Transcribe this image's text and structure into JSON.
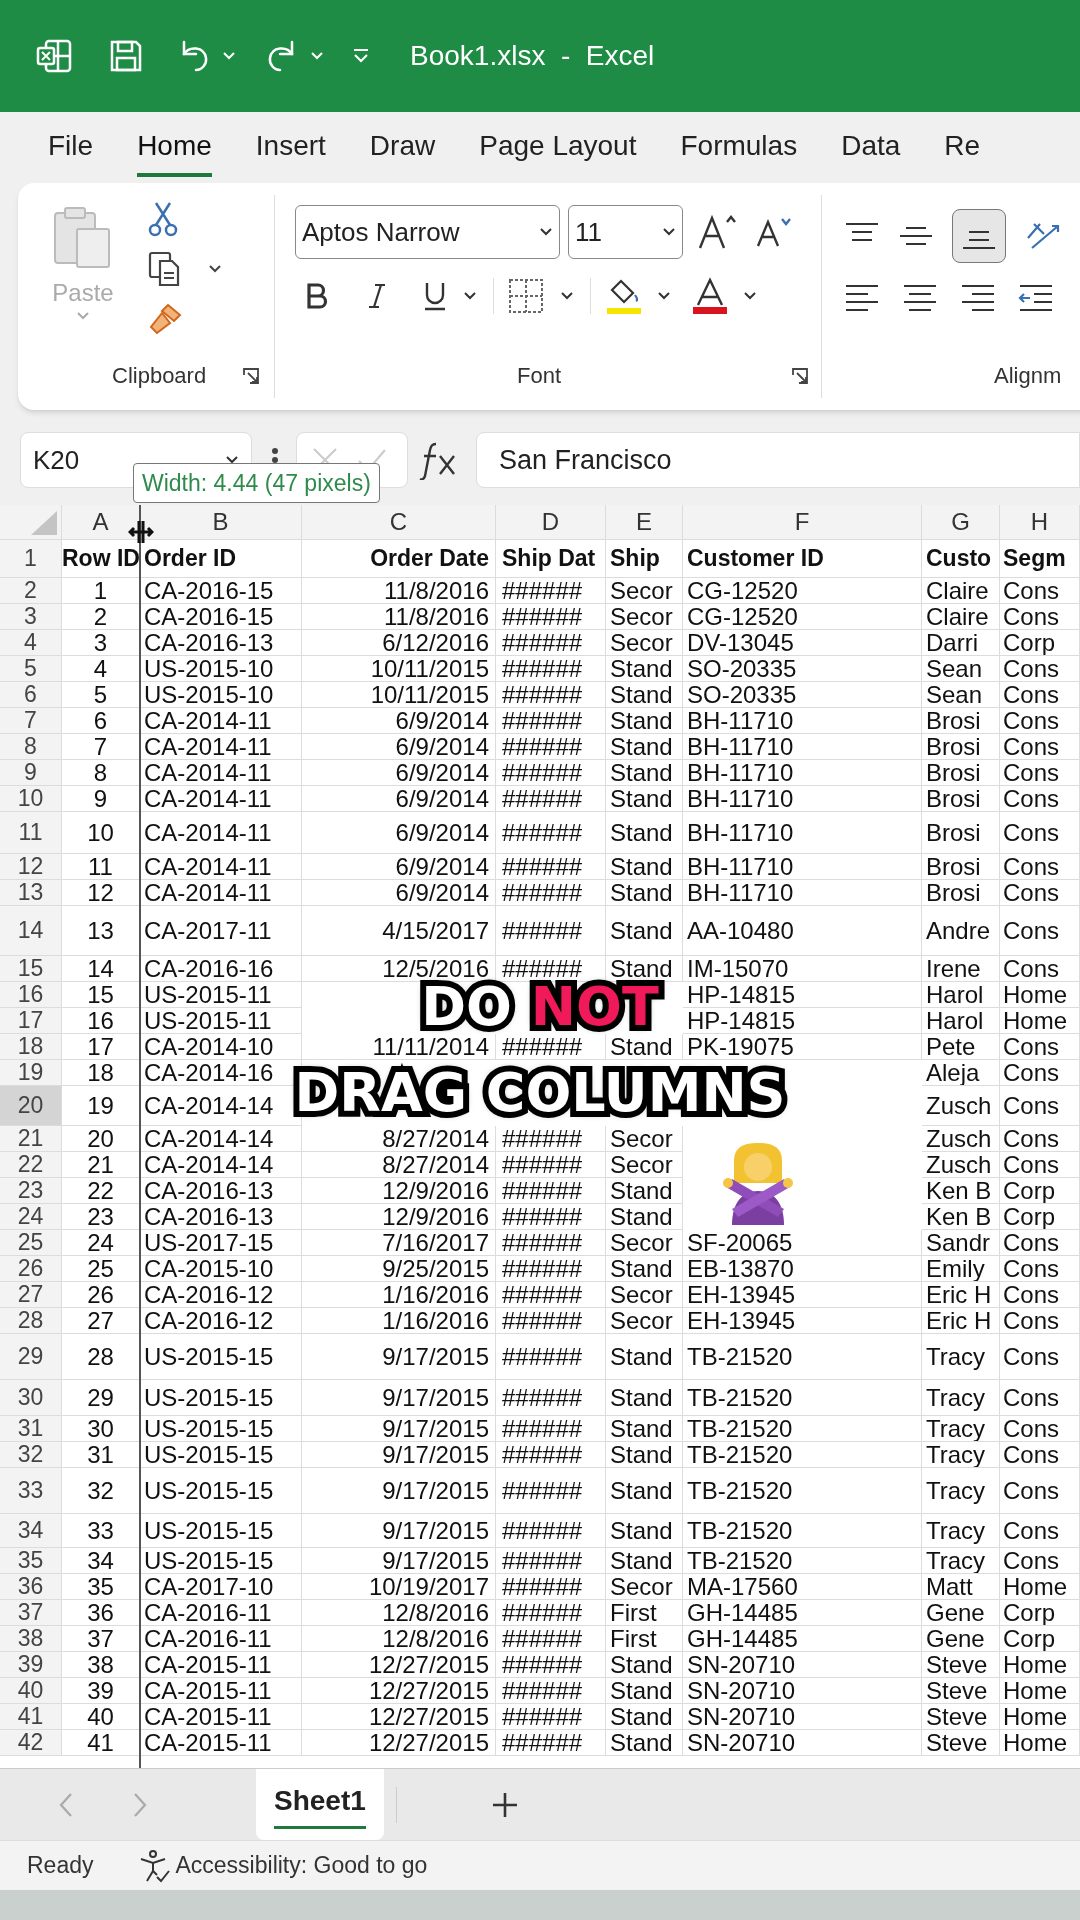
{
  "title_bar": {
    "title": "Book1.xlsx  -  Excel"
  },
  "ribbon_tabs": [
    {
      "label": "File",
      "selected": false
    },
    {
      "label": "Home",
      "selected": true
    },
    {
      "label": "Insert",
      "selected": false
    },
    {
      "label": "Draw",
      "selected": false
    },
    {
      "label": "Page Layout",
      "selected": false
    },
    {
      "label": "Formulas",
      "selected": false
    },
    {
      "label": "Data",
      "selected": false
    },
    {
      "label": "Re",
      "selected": false
    }
  ],
  "ribbon": {
    "paste_label": "Paste",
    "font_name": "Aptos Narrow",
    "font_size": "11",
    "group_labels": [
      "Clipboard",
      "Font",
      "Alignm"
    ]
  },
  "formula_bar": {
    "name_box": "K20",
    "formula": "San Francisco"
  },
  "tooltip": "Width: 4.44 (47 pixels)",
  "columns": [
    "A",
    "B",
    "C",
    "D",
    "E",
    "F",
    "G",
    "H"
  ],
  "header_row": {
    "number": "1",
    "cells": [
      "Row ID",
      "Order ID",
      "Order Date",
      "Ship Dat",
      "Ship",
      "Customer ID",
      "Custo",
      "Segm"
    ]
  },
  "rows": [
    {
      "number": "2",
      "selected": false,
      "cells": [
        "1",
        "CA-2016-15",
        "11/8/2016",
        "######",
        "Secor",
        "CG-12520",
        "Claire",
        "Cons"
      ]
    },
    {
      "number": "3",
      "selected": false,
      "cells": [
        "2",
        "CA-2016-15",
        "11/8/2016",
        "######",
        "Secor",
        "CG-12520",
        "Claire",
        "Cons"
      ]
    },
    {
      "number": "4",
      "selected": false,
      "cells": [
        "3",
        "CA-2016-13",
        "6/12/2016",
        "######",
        "Secor",
        "DV-13045",
        "Darri",
        "Corp"
      ]
    },
    {
      "number": "5",
      "selected": false,
      "cells": [
        "4",
        "US-2015-10",
        "10/11/2015",
        "######",
        "Stand",
        "SO-20335",
        "Sean",
        "Cons"
      ]
    },
    {
      "number": "6",
      "selected": false,
      "cells": [
        "5",
        "US-2015-10",
        "10/11/2015",
        "######",
        "Stand",
        "SO-20335",
        "Sean",
        "Cons"
      ]
    },
    {
      "number": "7",
      "selected": false,
      "cells": [
        "6",
        "CA-2014-11",
        "6/9/2014",
        "######",
        "Stand",
        "BH-11710",
        "Brosi",
        "Cons"
      ]
    },
    {
      "number": "8",
      "selected": false,
      "cells": [
        "7",
        "CA-2014-11",
        "6/9/2014",
        "######",
        "Stand",
        "BH-11710",
        "Brosi",
        "Cons"
      ]
    },
    {
      "number": "9",
      "selected": false,
      "cells": [
        "8",
        "CA-2014-11",
        "6/9/2014",
        "######",
        "Stand",
        "BH-11710",
        "Brosi",
        "Cons"
      ]
    },
    {
      "number": "10",
      "selected": false,
      "cells": [
        "9",
        "CA-2014-11",
        "6/9/2014",
        "######",
        "Stand",
        "BH-11710",
        "Brosi",
        "Cons"
      ]
    },
    {
      "number": "11",
      "selected": false,
      "cells": [
        "10",
        "CA-2014-11",
        "6/9/2014",
        "######",
        "Stand",
        "BH-11710",
        "Brosi",
        "Cons"
      ]
    },
    {
      "number": "12",
      "selected": false,
      "cells": [
        "11",
        "CA-2014-11",
        "6/9/2014",
        "######",
        "Stand",
        "BH-11710",
        "Brosi",
        "Cons"
      ]
    },
    {
      "number": "13",
      "selected": false,
      "cells": [
        "12",
        "CA-2014-11",
        "6/9/2014",
        "######",
        "Stand",
        "BH-11710",
        "Brosi",
        "Cons"
      ]
    },
    {
      "number": "14",
      "selected": false,
      "cells": [
        "13",
        "CA-2017-11",
        "4/15/2017",
        "######",
        "Stand",
        "AA-10480",
        "Andre",
        "Cons"
      ]
    },
    {
      "number": "15",
      "selected": false,
      "cells": [
        "14",
        "CA-2016-16",
        "12/5/2016",
        "######",
        "Stand",
        "IM-15070",
        "Irene",
        "Cons"
      ]
    },
    {
      "number": "16",
      "selected": false,
      "cells": [
        "15",
        "US-2015-11",
        null,
        null,
        null,
        "HP-14815",
        "Harol",
        "Home"
      ]
    },
    {
      "number": "17",
      "selected": false,
      "cells": [
        "16",
        "US-2015-11",
        null,
        null,
        null,
        "HP-14815",
        "Harol",
        "Home"
      ]
    },
    {
      "number": "18",
      "selected": false,
      "cells": [
        "17",
        "CA-2014-10",
        "11/11/2014",
        "######",
        "Stand",
        "PK-19075",
        "Pete",
        "Cons"
      ]
    },
    {
      "number": "19",
      "selected": false,
      "cells": [
        "18",
        "CA-2014-16",
        null,
        null,
        null,
        null,
        "Aleja",
        "Cons"
      ]
    },
    {
      "number": "20",
      "selected": true,
      "cells": [
        "19",
        "CA-2014-14",
        null,
        null,
        null,
        null,
        "Zusch",
        "Cons"
      ]
    },
    {
      "number": "21",
      "selected": false,
      "cells": [
        "20",
        "CA-2014-14",
        "8/27/2014",
        "######",
        "Secor",
        null,
        "Zusch",
        "Cons"
      ]
    },
    {
      "number": "22",
      "selected": false,
      "cells": [
        "21",
        "CA-2014-14",
        "8/27/2014",
        "######",
        "Secor",
        null,
        "Zusch",
        "Cons"
      ]
    },
    {
      "number": "23",
      "selected": false,
      "cells": [
        "22",
        "CA-2016-13",
        "12/9/2016",
        "######",
        "Stand",
        null,
        "Ken B",
        "Corp"
      ]
    },
    {
      "number": "24",
      "selected": false,
      "cells": [
        "23",
        "CA-2016-13",
        "12/9/2016",
        "######",
        "Stand",
        null,
        "Ken B",
        "Corp"
      ]
    },
    {
      "number": "25",
      "selected": false,
      "cells": [
        "24",
        "US-2017-15",
        "7/16/2017",
        "######",
        "Secor",
        "SF-20065",
        "Sandr",
        "Cons"
      ]
    },
    {
      "number": "26",
      "selected": false,
      "cells": [
        "25",
        "CA-2015-10",
        "9/25/2015",
        "######",
        "Stand",
        "EB-13870",
        "Emily",
        "Cons"
      ]
    },
    {
      "number": "27",
      "selected": false,
      "cells": [
        "26",
        "CA-2016-12",
        "1/16/2016",
        "######",
        "Secor",
        "EH-13945",
        "Eric H",
        "Cons"
      ]
    },
    {
      "number": "28",
      "selected": false,
      "cells": [
        "27",
        "CA-2016-12",
        "1/16/2016",
        "######",
        "Secor",
        "EH-13945",
        "Eric H",
        "Cons"
      ]
    },
    {
      "number": "29",
      "selected": false,
      "cells": [
        "28",
        "US-2015-15",
        "9/17/2015",
        "######",
        "Stand",
        "TB-21520",
        "Tracy",
        "Cons"
      ]
    },
    {
      "number": "30",
      "selected": false,
      "cells": [
        "29",
        "US-2015-15",
        "9/17/2015",
        "######",
        "Stand",
        "TB-21520",
        "Tracy",
        "Cons"
      ]
    },
    {
      "number": "31",
      "selected": false,
      "cells": [
        "30",
        "US-2015-15",
        "9/17/2015",
        "######",
        "Stand",
        "TB-21520",
        "Tracy",
        "Cons"
      ]
    },
    {
      "number": "32",
      "selected": false,
      "cells": [
        "31",
        "US-2015-15",
        "9/17/2015",
        "######",
        "Stand",
        "TB-21520",
        "Tracy",
        "Cons"
      ]
    },
    {
      "number": "33",
      "selected": false,
      "cells": [
        "32",
        "US-2015-15",
        "9/17/2015",
        "######",
        "Stand",
        "TB-21520",
        "Tracy",
        "Cons"
      ]
    },
    {
      "number": "34",
      "selected": false,
      "cells": [
        "33",
        "US-2015-15",
        "9/17/2015",
        "######",
        "Stand",
        "TB-21520",
        "Tracy",
        "Cons"
      ]
    },
    {
      "number": "35",
      "selected": false,
      "cells": [
        "34",
        "US-2015-15",
        "9/17/2015",
        "######",
        "Stand",
        "TB-21520",
        "Tracy",
        "Cons"
      ]
    },
    {
      "number": "36",
      "selected": false,
      "cells": [
        "35",
        "CA-2017-10",
        "10/19/2017",
        "######",
        "Secor",
        "MA-17560",
        "Matt",
        "Home"
      ]
    },
    {
      "number": "37",
      "selected": false,
      "cells": [
        "36",
        "CA-2016-11",
        "12/8/2016",
        "######",
        "First",
        "GH-14485",
        "Gene",
        "Corp"
      ]
    },
    {
      "number": "38",
      "selected": false,
      "cells": [
        "37",
        "CA-2016-11",
        "12/8/2016",
        "######",
        "First",
        "GH-14485",
        "Gene",
        "Corp"
      ]
    },
    {
      "number": "39",
      "selected": false,
      "cells": [
        "38",
        "CA-2015-11",
        "12/27/2015",
        "######",
        "Stand",
        "SN-20710",
        "Steve",
        "Home"
      ]
    },
    {
      "number": "40",
      "selected": false,
      "cells": [
        "39",
        "CA-2015-11",
        "12/27/2015",
        "######",
        "Stand",
        "SN-20710",
        "Steve",
        "Home"
      ]
    },
    {
      "number": "41",
      "selected": false,
      "cells": [
        "40",
        "CA-2015-11",
        "12/27/2015",
        "######",
        "Stand",
        "SN-20710",
        "Steve",
        "Home"
      ]
    },
    {
      "number": "42",
      "selected": false,
      "cells": [
        "41",
        "CA-2015-11",
        "12/27/2015",
        "######",
        "Stand",
        "SN-20710",
        "Steve",
        "Home"
      ]
    }
  ],
  "caption": [
    [
      {
        "text": "DO",
        "color": "#ffffff"
      },
      {
        "text": "NOT",
        "color": "#f0195a"
      }
    ],
    [
      {
        "text": "DRAG COLUMNS",
        "color": "#ffffff"
      }
    ]
  ],
  "sheet_tabs": [
    {
      "label": "Sheet1",
      "selected": true
    }
  ],
  "status_bar": {
    "mode": "Ready",
    "accessibility": "Accessibility: Good to go"
  }
}
